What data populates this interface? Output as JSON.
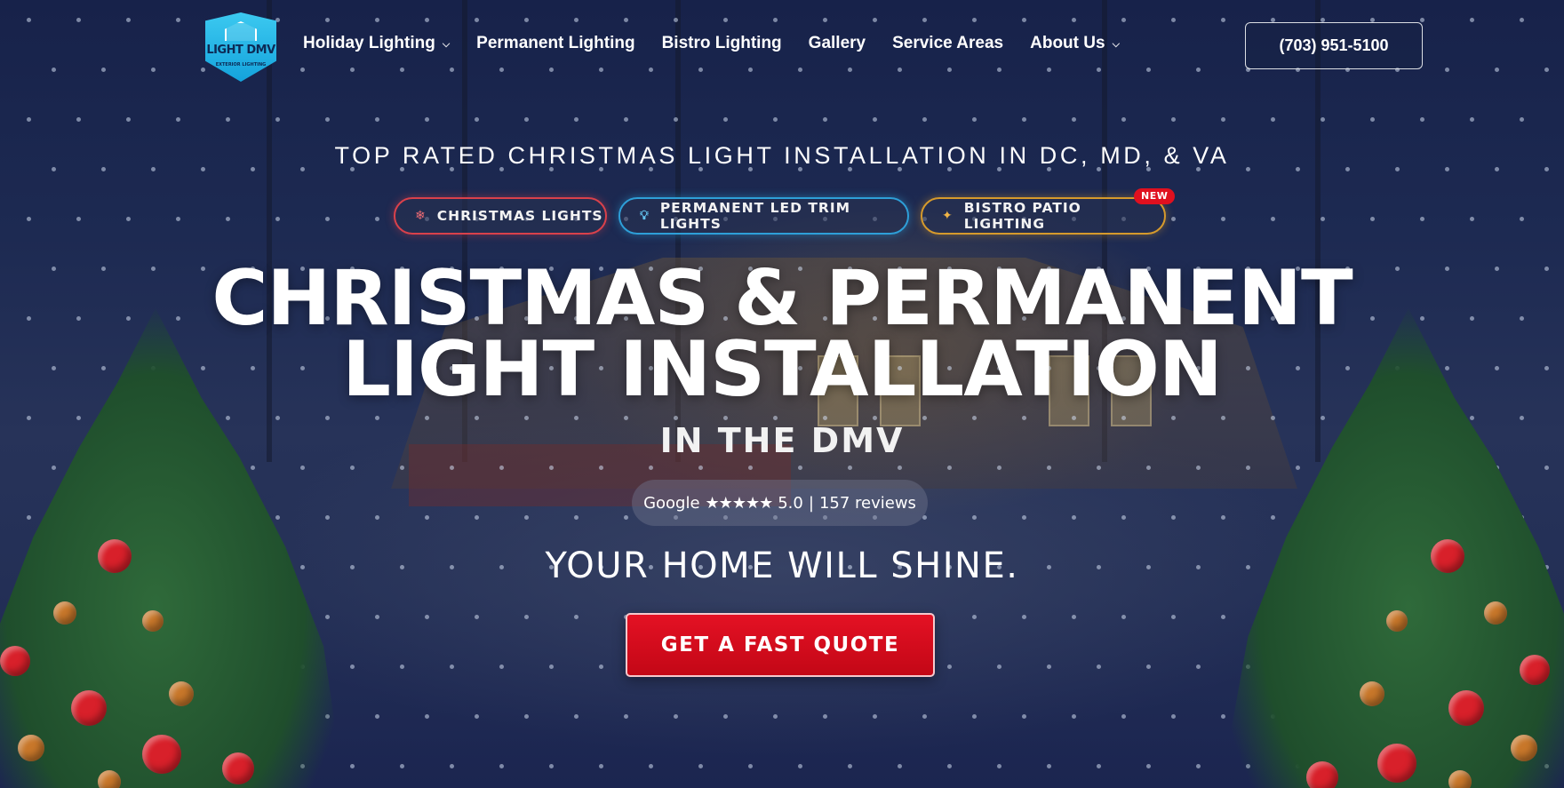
{
  "logo": {
    "text": "LIGHT DMV",
    "subtext": "EXTERIOR LIGHTING"
  },
  "nav": {
    "items": [
      {
        "label": "Holiday Lighting",
        "has_dropdown": true
      },
      {
        "label": "Permanent Lighting",
        "has_dropdown": false
      },
      {
        "label": "Bistro Lighting",
        "has_dropdown": false
      },
      {
        "label": "Gallery",
        "has_dropdown": false
      },
      {
        "label": "Service Areas",
        "has_dropdown": false
      },
      {
        "label": "About Us",
        "has_dropdown": true
      }
    ],
    "phone": "(703) 951-5100"
  },
  "hero": {
    "eyebrow": "TOP RATED CHRISTMAS LIGHT INSTALLATION IN DC, MD, & VA",
    "pills": [
      {
        "label": "CHRISTMAS LIGHTS",
        "icon": "snowflake-icon",
        "color": "#d9414b"
      },
      {
        "label": "PERMANENT LED TRIM LIGHTS",
        "icon": "lightbulb-icon",
        "color": "#2e9fd8"
      },
      {
        "label": "BISTRO PATIO LIGHTING",
        "icon": "sparkle-icon",
        "color": "#d69a2c"
      }
    ],
    "new_badge": "NEW",
    "headline_line1": "CHRISTMAS & PERMANENT",
    "headline_line2": "LIGHT INSTALLATION",
    "subheadline": "IN THE DMV",
    "reviews": {
      "source": "Google",
      "stars": "★★★★★",
      "rating": "5.0",
      "separator": "|",
      "count_text": "157 reviews"
    },
    "tagline": "YOUR HOME WILL SHINE.",
    "cta": "GET A FAST QUOTE"
  },
  "colors": {
    "cta_red": "#e41124",
    "background_navy": "#1d2a52",
    "logo_blue": "#3cc9f0"
  }
}
